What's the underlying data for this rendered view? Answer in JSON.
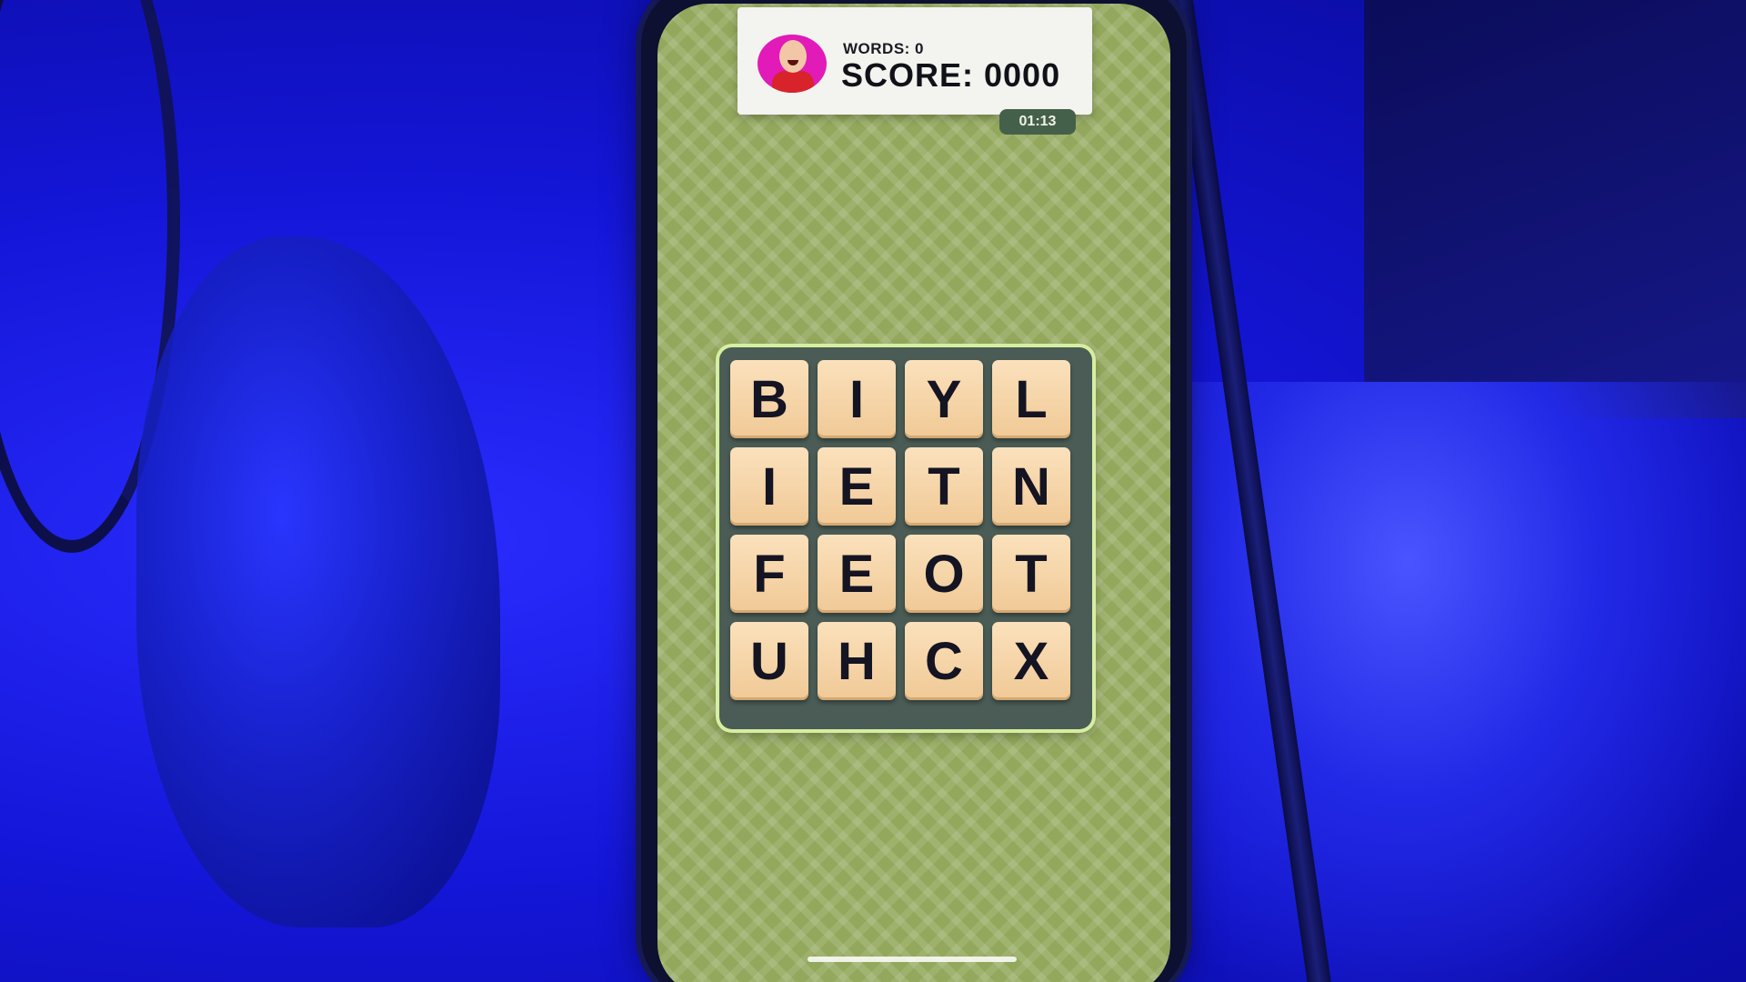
{
  "header": {
    "words_label": "WORDS: 0",
    "score_label": "SCORE: 0000"
  },
  "timer": "01:13",
  "board": {
    "letters": [
      [
        "B",
        "I",
        "Y",
        "L"
      ],
      [
        "I",
        "E",
        "T",
        "N"
      ],
      [
        "F",
        "E",
        "O",
        "T"
      ],
      [
        "U",
        "H",
        "C",
        "X"
      ]
    ]
  },
  "colors": {
    "background": "#93a85c",
    "tile": "#f6d3a6",
    "board_frame": "#d6eea0",
    "avatar_bg": "#e11ab8"
  }
}
